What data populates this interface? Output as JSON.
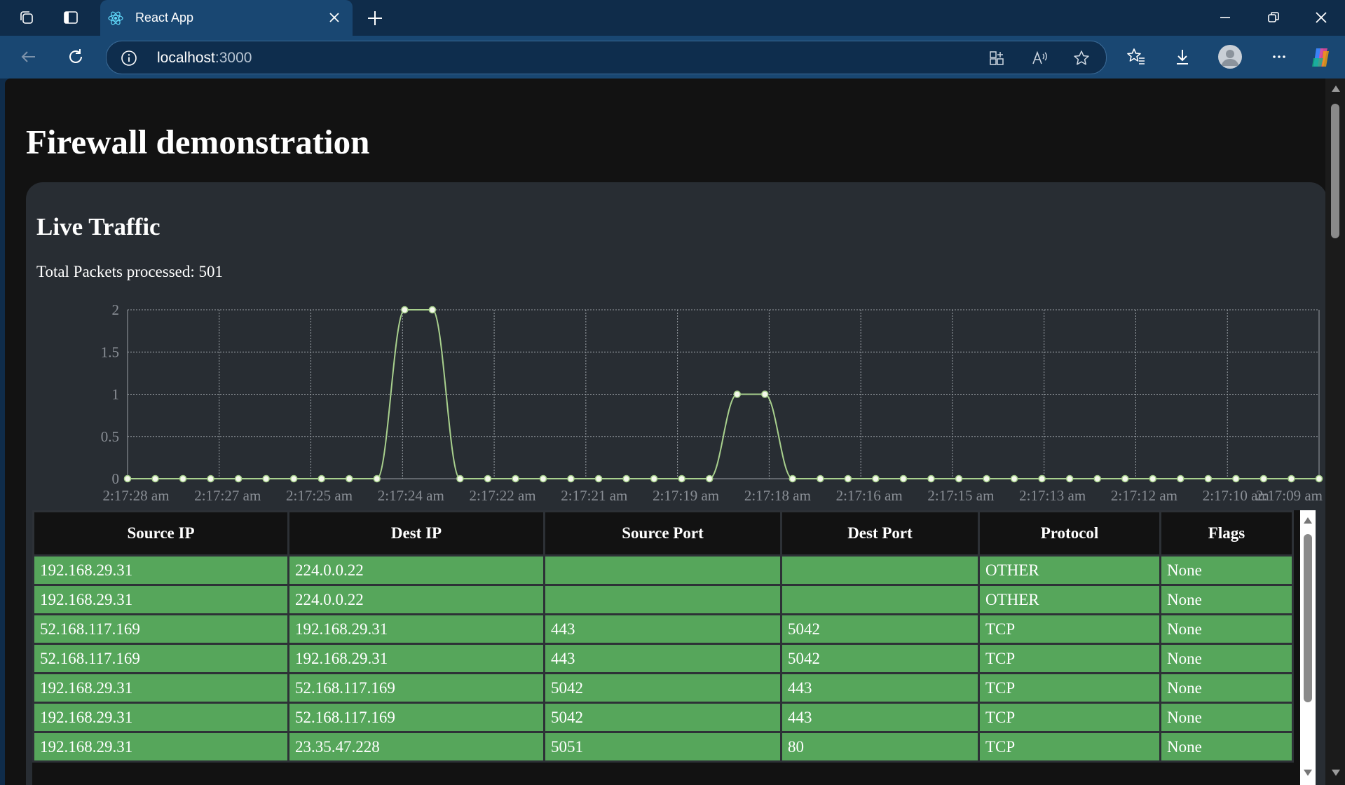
{
  "browser": {
    "tab_title": "React App",
    "address_host": "localhost",
    "address_port": ":3000"
  },
  "page": {
    "title": "Firewall demonstration"
  },
  "live_traffic": {
    "title": "Live Traffic",
    "total_label": "Total Packets processed: 501"
  },
  "chart_data": {
    "type": "line",
    "title": "",
    "xlabel": "",
    "ylabel": "",
    "ylim": [
      0,
      2
    ],
    "yticks": [
      "0",
      "0.5",
      "1",
      "1.5",
      "2"
    ],
    "xtick_labels": [
      "2:17:28 am",
      "2:17:27 am",
      "2:17:25 am",
      "2:17:24 am",
      "2:17:22 am",
      "2:17:21 am",
      "2:17:19 am",
      "2:17:18 am",
      "2:17:16 am",
      "2:17:15 am",
      "2:17:13 am",
      "2:17:12 am",
      "2:17:10 am",
      "2:17:09 am"
    ],
    "values": [
      0,
      0,
      0,
      0,
      0,
      0,
      0,
      0,
      0,
      0,
      2,
      2,
      0,
      0,
      0,
      0,
      0,
      0,
      0,
      0,
      0,
      0,
      1,
      1,
      0,
      0,
      0,
      0,
      0,
      0,
      0,
      0,
      0,
      0,
      0,
      0,
      0,
      0,
      0,
      0,
      0,
      0,
      0,
      0
    ],
    "line_color": "#a8d08d",
    "grid": true
  },
  "table": {
    "headers": [
      "Source IP",
      "Dest IP",
      "Source Port",
      "Dest Port",
      "Protocol",
      "Flags"
    ],
    "rows": [
      [
        "192.168.29.31",
        "224.0.0.22",
        "",
        "",
        "OTHER",
        "None"
      ],
      [
        "192.168.29.31",
        "224.0.0.22",
        "",
        "",
        "OTHER",
        "None"
      ],
      [
        "52.168.117.169",
        "192.168.29.31",
        "443",
        "5042",
        "TCP",
        "None"
      ],
      [
        "52.168.117.169",
        "192.168.29.31",
        "443",
        "5042",
        "TCP",
        "None"
      ],
      [
        "192.168.29.31",
        "52.168.117.169",
        "5042",
        "443",
        "TCP",
        "None"
      ],
      [
        "192.168.29.31",
        "52.168.117.169",
        "5042",
        "443",
        "TCP",
        "None"
      ],
      [
        "192.168.29.31",
        "23.35.47.228",
        "5051",
        "80",
        "TCP",
        "None"
      ]
    ],
    "row_color": "#56a65b"
  }
}
